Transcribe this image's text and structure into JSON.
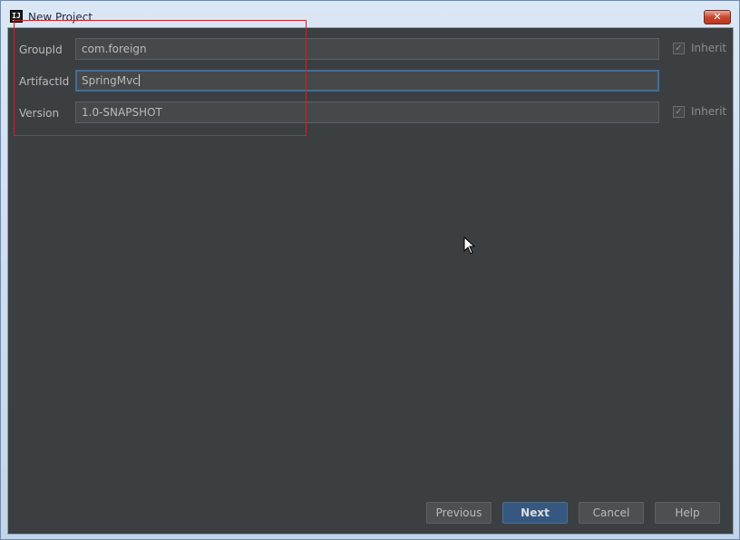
{
  "window": {
    "title": "New Project",
    "app_icon_text": "IJ",
    "close_glyph": "✕"
  },
  "form": {
    "group_id": {
      "label": "GroupId",
      "value": "com.foreign",
      "inherit_label": "Inherit",
      "inherit_checked": true
    },
    "artifact_id": {
      "label": "ArtifactId",
      "value": "SpringMvc"
    },
    "version": {
      "label": "Version",
      "value": "1.0-SNAPSHOT",
      "inherit_label": "Inherit",
      "inherit_checked": true
    }
  },
  "footer": {
    "previous_label": "Previous",
    "next_label": "Next",
    "cancel_label": "Cancel",
    "help_label": "Help"
  },
  "icons": {
    "check_glyph": "✓"
  },
  "colors": {
    "panel_bg": "#3c3f41",
    "field_bg": "#45494a",
    "accent": "#365880",
    "annotation": "#d0202a"
  }
}
